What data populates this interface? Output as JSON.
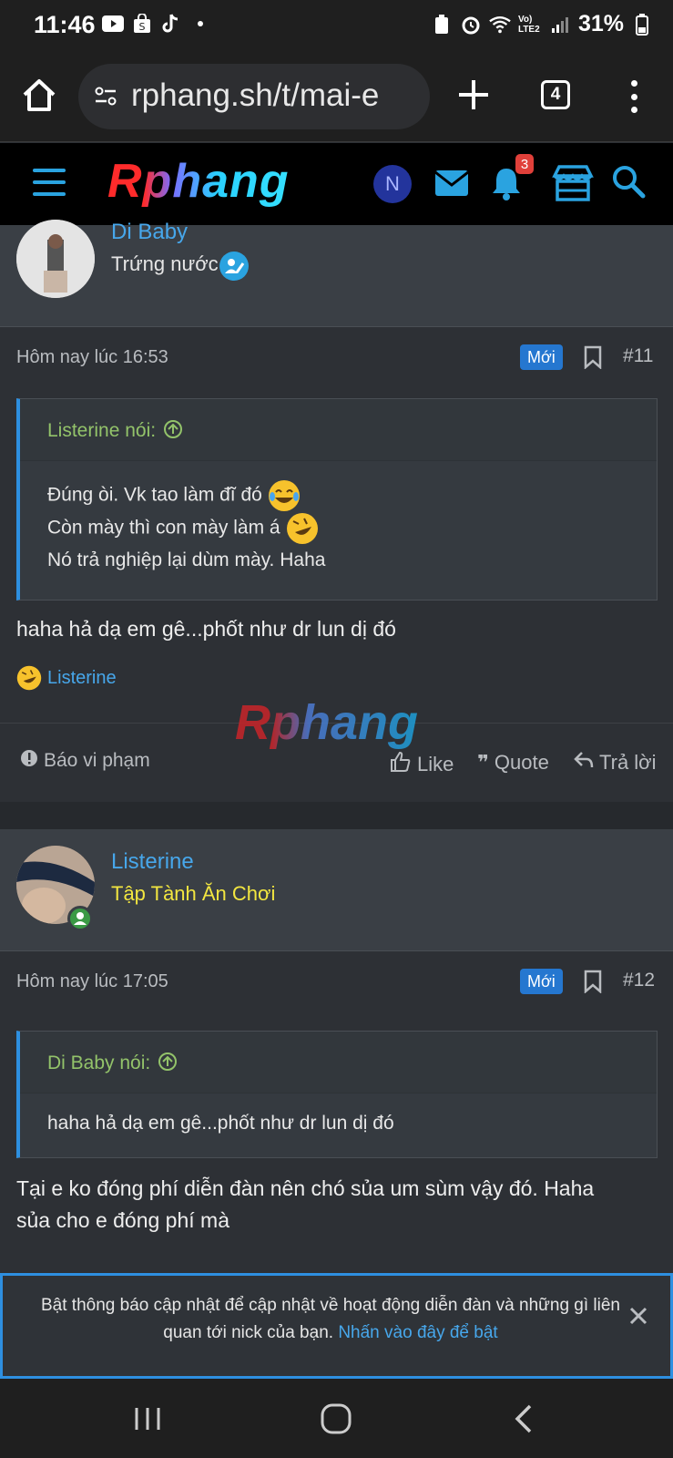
{
  "status_bar": {
    "time": "11:46",
    "battery": "31%",
    "network": "Vo) LTE2"
  },
  "browser": {
    "url": "rphang.sh/t/mai-e",
    "tab_count": "4"
  },
  "forum": {
    "logo": "Rphang",
    "user_initial": "N",
    "notification_count": "3"
  },
  "posts": [
    {
      "username": "Di Baby",
      "user_title": "Trứng nước",
      "time": "Hôm nay lúc 16:53",
      "new_label": "Mới",
      "number": "#11",
      "quote_author": "Listerine nói:",
      "quote_lines": [
        "Đúng òi. Vk tao làm đĩ đó",
        "Còn mày thì con mày làm á",
        "Nó trả nghiệp lại dùm mày. Haha"
      ],
      "body": "haha hả dạ em gê...phốt như dr lun dị đó",
      "reaction_user": "Listerine",
      "actions": {
        "report": "Báo vi phạm",
        "like": "Like",
        "quote": "Quote",
        "reply": "Trả lời"
      }
    },
    {
      "username": "Listerine",
      "user_title": "Tập Tành Ăn Chơi",
      "time": "Hôm nay lúc 17:05",
      "new_label": "Mới",
      "number": "#12",
      "quote_author": "Di Baby nói:",
      "quote_lines": [
        "haha hả dạ em gê...phốt như dr lun dị đó"
      ],
      "body_lines": [
        "Tại e ko đóng phí diễn đàn nên chó sủa um sùm vậy đó. Haha",
        "sủa cho e đóng phí mà"
      ]
    }
  ],
  "watermark": "Rphang",
  "notification": {
    "text": "Bật thông báo cập nhật để cập nhật về hoạt động diễn đàn và những gì liên quan tới nick của bạn.",
    "link": "Nhấn vào đây để bật"
  },
  "colors": {
    "accent": "#47a7eb",
    "quote_attr": "#93c36a",
    "user_title_2": "#f2e640",
    "badge_new": "#2577d0"
  }
}
